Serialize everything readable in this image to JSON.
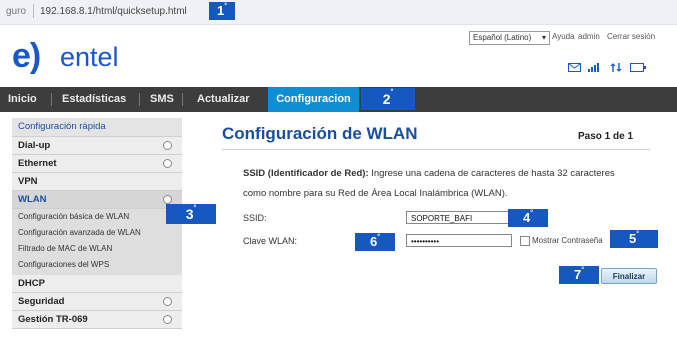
{
  "browser": {
    "secure_label": "guro",
    "url": "192.168.8.1/html/quicksetup.html"
  },
  "header": {
    "logo_mark": "e)",
    "logo_text": "entel",
    "language": "Español (Latino)",
    "links": [
      "Ayuda",
      "admin",
      "Cerrar sesión"
    ],
    "status_icons": [
      "mail-icon",
      "signal-icon",
      "data-transfer-icon",
      "battery-icon"
    ]
  },
  "nav": {
    "items": [
      "Inicio",
      "Estadísticas",
      "SMS",
      "Actualizar"
    ],
    "active": "Configuracion"
  },
  "sidebar": {
    "top_link": "Configuración rápida",
    "items": [
      "Dial-up",
      "Ethernet",
      "VPN",
      "WLAN"
    ],
    "wlan_subitems": [
      "Configuración básica de WLAN",
      "Configuración avanzada de WLAN",
      "Filtrado de MAC de WLAN",
      "Configuraciones del WPS"
    ],
    "bottom_items": [
      "DHCP",
      "Seguridad",
      "Gestión TR-069"
    ]
  },
  "content": {
    "title": "Configuración de WLAN",
    "step": "Paso 1 de 1",
    "description_bold": "SSID (Identificador de Red):",
    "description_rest": " Ingrese una cadena de caracteres de hasta 32 caracteres",
    "description_line2": "como nombre para su Red de Área Local Inalámbrica (WLAN).",
    "ssid_label": "SSID:",
    "ssid_value": "SOPORTE_BAFI",
    "key_label": "Clave WLAN:",
    "key_value": "••••••••••",
    "show_password_label": "Mostrar Contraseña",
    "finish_button": "Finalizar"
  },
  "badges": {
    "b1": "1",
    "b2": "2",
    "b3": "3",
    "b4": "4",
    "b5": "5",
    "b6": "6",
    "b7": "7",
    "degree": "°",
    "color": "#1558c0"
  },
  "colors": {
    "brand": "#1a57c8",
    "nav_bg": "#3d3d3d",
    "nav_active": "#0f8fd3",
    "title": "#1a4fa0"
  }
}
